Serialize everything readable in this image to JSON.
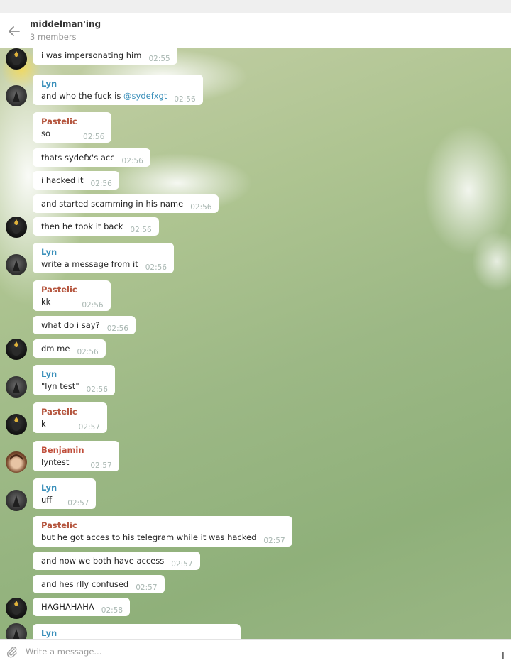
{
  "header": {
    "title": "middelman'ing",
    "members": "3 members"
  },
  "messages": [
    {
      "text": "i was impersonating him",
      "time": "02:55"
    },
    {
      "sender": "Lyn",
      "text_prefix": "and who the fuck is ",
      "mention": "@sydefxgt",
      "time": "02:56"
    },
    {
      "sender": "Pastelic",
      "text": "so",
      "time": "02:56"
    },
    {
      "text": "thats sydefx's acc",
      "time": "02:56"
    },
    {
      "text": "i hacked it",
      "time": "02:56"
    },
    {
      "text": "and started scamming in his name",
      "time": "02:56"
    },
    {
      "text": "then he took it back",
      "time": "02:56"
    },
    {
      "sender": "Lyn",
      "text": "write a message from it",
      "time": "02:56"
    },
    {
      "sender": "Pastelic",
      "text": "kk",
      "time": "02:56"
    },
    {
      "text": "what do i say?",
      "time": "02:56"
    },
    {
      "text": "dm me",
      "time": "02:56"
    },
    {
      "sender": "Lyn",
      "text": "\"lyn test\"",
      "time": "02:56"
    },
    {
      "sender": "Pastelic",
      "text": "k",
      "time": "02:57"
    },
    {
      "sender": "Benjamin",
      "text": "lyntest",
      "time": "02:57"
    },
    {
      "sender": "Lyn",
      "text": "uff",
      "time": "02:57"
    },
    {
      "sender": "Pastelic",
      "text": "but he got acces to his telegram while it was hacked",
      "time": "02:57"
    },
    {
      "text": "and now we both have access",
      "time": "02:57"
    },
    {
      "text": "and hes rlly confused",
      "time": "02:57"
    },
    {
      "text": "HAGHAHAHA",
      "time": "02:58"
    },
    {
      "sender": "Lyn"
    }
  ],
  "composer": {
    "placeholder": "Write a message..."
  },
  "colors": {
    "lyn": "#3a8fba",
    "pastelic": "#b5563f",
    "benjamin": "#c04f3c"
  },
  "icons": {
    "back": "arrow-left-icon",
    "attach": "paperclip-icon"
  }
}
